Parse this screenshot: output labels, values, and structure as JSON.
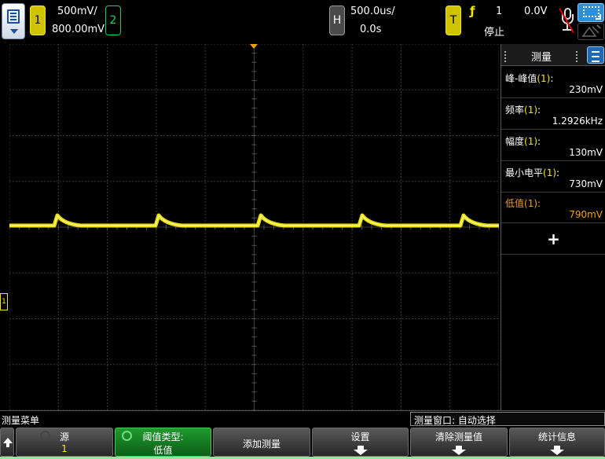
{
  "top_bar": {
    "channel1": {
      "label": "1",
      "scale": "500mV/",
      "offset": "800.00mV"
    },
    "channel2": {
      "label": "2"
    },
    "horizontal": {
      "label": "H",
      "timebase": "500.0us/",
      "delay": "0.0s"
    },
    "trigger": {
      "label": "T",
      "source": "1",
      "level": "0.0V",
      "state": "停止"
    }
  },
  "measurements_panel": {
    "title": "测量",
    "items": [
      {
        "name": "峰-峰值",
        "channel": "(1)",
        "suffix": ":",
        "value": "230mV"
      },
      {
        "name": "频率",
        "channel": "(1)",
        "suffix": ":",
        "value": "1.2926kHz"
      },
      {
        "name": "幅度",
        "channel": "(1)",
        "suffix": ":",
        "value": "130mV"
      },
      {
        "name": "最小电平",
        "channel": "(1)",
        "suffix": ":",
        "value": "730mV"
      },
      {
        "name": "低值",
        "channel": "(1)",
        "suffix": ":",
        "value": "790mV"
      }
    ],
    "add_label": "+"
  },
  "status_bar": {
    "menu_name": "测量菜单",
    "window_info": "测量窗口: 自动选择"
  },
  "softkeys": {
    "source_label": "源",
    "source_value": "1",
    "threshold_label": "阈值类型:",
    "threshold_value": "低值",
    "add_measurement": "添加测量",
    "settings": "设置",
    "clear_measurements": "清除测量值",
    "statistics": "统计信息"
  },
  "colors": {
    "channel1": "#f2e900",
    "channel2": "#1ed15a",
    "highlight": "#f0a018",
    "grid": "#3a3a3a"
  }
}
